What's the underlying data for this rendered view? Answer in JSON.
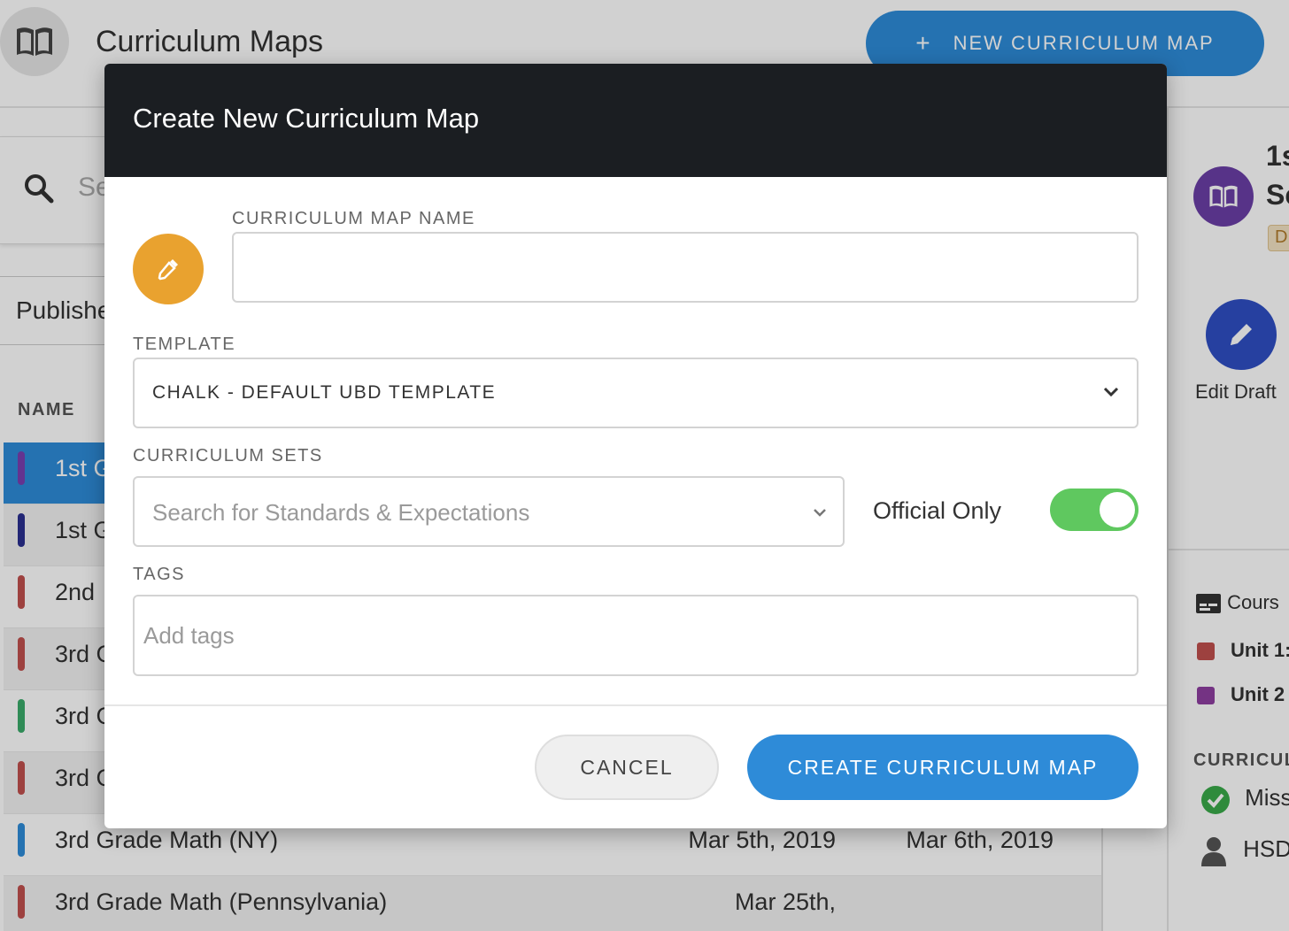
{
  "app": {
    "title": "Curriculum Maps",
    "new_button_label": "NEW CURRICULUM MAP",
    "search_placeholder": "Se",
    "filter_value": "Publishe",
    "column_name": "NAME",
    "rows": [
      {
        "name": "1st G",
        "color": "#7b3fb0",
        "date1": "",
        "date2": ""
      },
      {
        "name": "1st G",
        "color": "#2a2f8f",
        "date1": "",
        "date2": ""
      },
      {
        "name": "2nd",
        "color": "#c0504d",
        "date1": "",
        "date2": ""
      },
      {
        "name": "3rd G",
        "color": "#c0504d",
        "date1": "",
        "date2": ""
      },
      {
        "name": "3rd G",
        "color": "#3aaa6a",
        "date1": "",
        "date2": ""
      },
      {
        "name": "3rd G",
        "color": "#c0504d",
        "date1": "",
        "date2": ""
      },
      {
        "name": "3rd Grade Math (NY)",
        "color": "#2e8bd8",
        "date1": "Mar 5th, 2019",
        "date2": "Mar 6th, 2019"
      },
      {
        "name": "3rd Grade Math (Pennsylvania)",
        "color": "#c0504d",
        "date1": "Mar 25th,",
        "date2": ""
      }
    ]
  },
  "side": {
    "title_line1": "1s",
    "title_line2": "Sc",
    "badge": "D",
    "edit_label": "Edit Draft",
    "course_label": "Cours",
    "unit1": "Unit 1:",
    "unit2": "Unit 2",
    "section_label": "CURRICUL",
    "mission": "Miss",
    "owner": "HSD"
  },
  "modal": {
    "title": "Create New Curriculum Map",
    "name_label": "CURRICULUM MAP NAME",
    "name_value": "",
    "template_label": "TEMPLATE",
    "template_value": "CHALK - DEFAULT UBD TEMPLATE",
    "sets_label": "CURRICULUM SETS",
    "sets_placeholder": "Search for Standards & Expectations",
    "official_only_label": "Official Only",
    "official_only_on": true,
    "tags_label": "TAGS",
    "tags_placeholder": "Add tags",
    "cancel_label": "CANCEL",
    "create_label": "CREATE CURRICULUM MAP"
  },
  "colors": {
    "primary": "#2e8bd8",
    "header_dark": "#1b1e22",
    "color_picker": "#e9a22f",
    "toggle_on": "#5fc85f",
    "avatar_purple": "#6b3fa6",
    "edit_blue": "#2f4fc4"
  },
  "icons": {
    "logo": "book-icon",
    "search": "search-icon",
    "color_picker": "eyedropper-icon",
    "dropdown": "chevron-down-icon",
    "edit": "pencil-icon",
    "course": "course-icon",
    "check": "check-circle-icon",
    "user": "user-icon"
  }
}
